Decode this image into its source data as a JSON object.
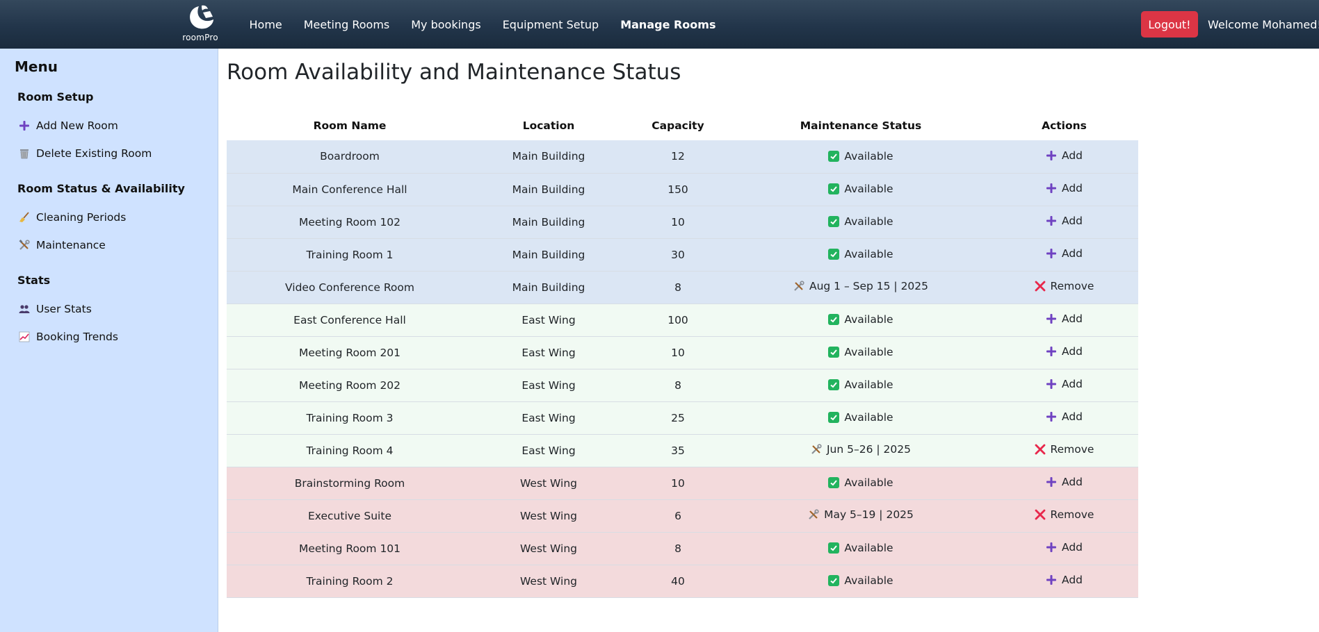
{
  "nav": {
    "brand": "roomPro",
    "links": [
      "Home",
      "Meeting Rooms",
      "My bookings",
      "Equipment Setup",
      "Manage Rooms"
    ],
    "active": "Manage Rooms",
    "logout_label": "Logout!",
    "welcome": "Welcome Mohamed!"
  },
  "sidebar": {
    "title": "Menu",
    "sections": [
      {
        "title": "Room Setup",
        "items": [
          {
            "label": "Add New Room",
            "icon": "plus-icon"
          },
          {
            "label": "Delete Existing Room",
            "icon": "wastebasket-icon"
          }
        ]
      },
      {
        "title": "Room Status & Availability",
        "items": [
          {
            "label": "Cleaning Periods",
            "icon": "broom-icon"
          },
          {
            "label": "Maintenance",
            "icon": "tools-icon"
          }
        ]
      },
      {
        "title": "Stats",
        "items": [
          {
            "label": "User Stats",
            "icon": "users-icon"
          },
          {
            "label": "Booking Trends",
            "icon": "chart-trend-icon"
          }
        ]
      }
    ]
  },
  "main": {
    "title": "Room Availability and Maintenance Status",
    "columns": [
      "Room Name",
      "Location",
      "Capacity",
      "Maintenance Status",
      "Actions"
    ],
    "rows": [
      {
        "name": "Boardroom",
        "location": "Main Building",
        "capacity": "12",
        "status": "Available",
        "available": true,
        "action": "Add",
        "group": "main"
      },
      {
        "name": "Main Conference Hall",
        "location": "Main Building",
        "capacity": "150",
        "status": "Available",
        "available": true,
        "action": "Add",
        "group": "main"
      },
      {
        "name": "Meeting Room 102",
        "location": "Main Building",
        "capacity": "10",
        "status": "Available",
        "available": true,
        "action": "Add",
        "group": "main"
      },
      {
        "name": "Training Room 1",
        "location": "Main Building",
        "capacity": "30",
        "status": "Available",
        "available": true,
        "action": "Add",
        "group": "main"
      },
      {
        "name": "Video Conference Room",
        "location": "Main Building",
        "capacity": "8",
        "status": "Aug 1 – Sep 15 | 2025",
        "available": false,
        "action": "Remove",
        "group": "main"
      },
      {
        "name": "East Conference Hall",
        "location": "East Wing",
        "capacity": "100",
        "status": "Available",
        "available": true,
        "action": "Add",
        "group": "east"
      },
      {
        "name": "Meeting Room 201",
        "location": "East Wing",
        "capacity": "10",
        "status": "Available",
        "available": true,
        "action": "Add",
        "group": "east"
      },
      {
        "name": "Meeting Room 202",
        "location": "East Wing",
        "capacity": "8",
        "status": "Available",
        "available": true,
        "action": "Add",
        "group": "east"
      },
      {
        "name": "Training Room 3",
        "location": "East Wing",
        "capacity": "25",
        "status": "Available",
        "available": true,
        "action": "Add",
        "group": "east"
      },
      {
        "name": "Training Room 4",
        "location": "East Wing",
        "capacity": "35",
        "status": "Jun 5–26 | 2025",
        "available": false,
        "action": "Remove",
        "group": "east"
      },
      {
        "name": "Brainstorming Room",
        "location": "West Wing",
        "capacity": "10",
        "status": "Available",
        "available": true,
        "action": "Add",
        "group": "west"
      },
      {
        "name": "Executive Suite",
        "location": "West Wing",
        "capacity": "6",
        "status": "May 5–19 | 2025",
        "available": false,
        "action": "Remove",
        "group": "west"
      },
      {
        "name": "Meeting Room 101",
        "location": "West Wing",
        "capacity": "8",
        "status": "Available",
        "available": true,
        "action": "Add",
        "group": "west"
      },
      {
        "name": "Training Room 2",
        "location": "West Wing",
        "capacity": "40",
        "status": "Available",
        "available": true,
        "action": "Add",
        "group": "west"
      }
    ]
  },
  "colors": {
    "navbar": "#22354a",
    "sidebar": "#cfe2ff",
    "logout": "#dc3545",
    "available_check": "#22b35e",
    "add_plus": "#6f42c1",
    "remove_x": "#e8274b",
    "row_main": "#dbe6f4",
    "row_east": "#f1faf3",
    "row_west": "#f3dadc"
  }
}
